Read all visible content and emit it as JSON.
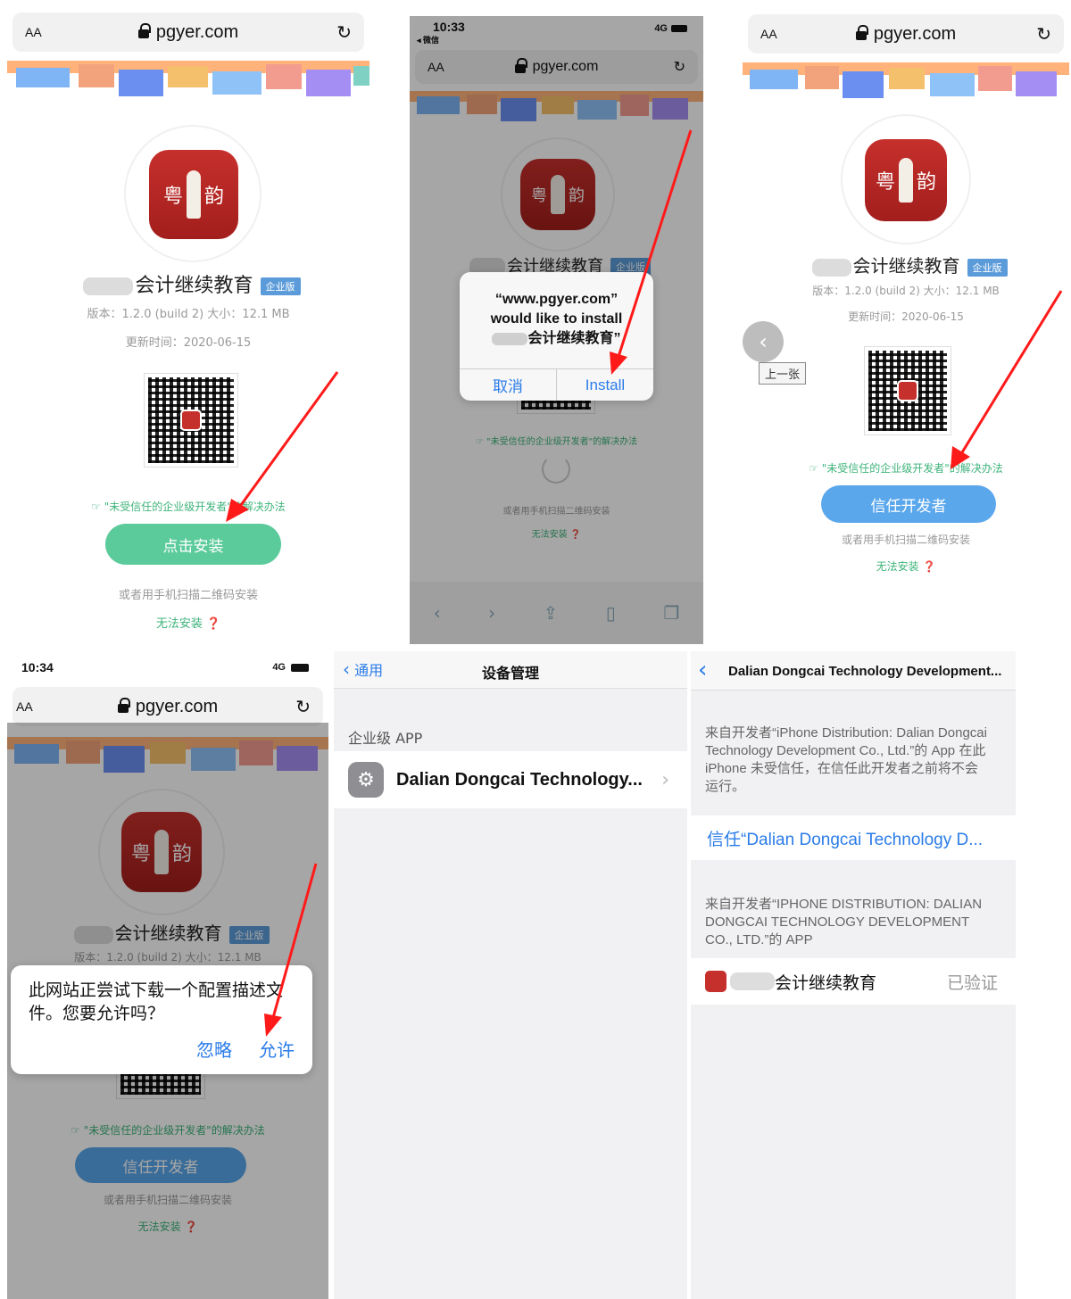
{
  "shared": {
    "aa": "AA",
    "reload": "↻",
    "app_suffix": "会计继续教育",
    "badge": "企业版",
    "version": "版本：1.2.0 (build 2)   大小：12.1 MB",
    "updated": "更新时间：2020-06-15",
    "untrusted_link": "\"未受信任的企业级开发者\"的解决办法",
    "scan_text": "或者用手机扫描二维码安装",
    "cannot_install": "无法安装"
  },
  "screen1": {
    "url": "pgyer.com",
    "install_button": "点击安装"
  },
  "screen2": {
    "time": "10:33",
    "back_app": "◂ 微信",
    "signal": "4G",
    "url": "pgyer.com",
    "alert_line1": "“www.pgyer.com”",
    "alert_line2": "would like to install",
    "alert_line3": "会计继续教育”",
    "cancel": "取消",
    "install": "Install"
  },
  "screen3": {
    "url": "pgyer.com",
    "prev_tooltip": "上一张",
    "trust_button": "信任开发者"
  },
  "screen4": {
    "time": "10:34",
    "signal": "4G",
    "url": "pgyer.com",
    "alert_text": "此网站正尝试下载一个配置描述文件。您要允许吗？",
    "ignore": "忽略",
    "allow": "允许",
    "trust_button": "信任开发者"
  },
  "screen5": {
    "back": "通用",
    "title": "设备管理",
    "section": "企业级 APP",
    "item": "Dalian Dongcai Technology..."
  },
  "screen6": {
    "title": "Dalian Dongcai Technology Development...",
    "desc": "来自开发者“iPhone Distribution: Dalian Dongcai Technology Development Co., Ltd.”的 App 在此 iPhone 未受信任，在信任此开发者之前将不会运行。",
    "trust_link": "信任“Dalian Dongcai Technology D...",
    "section": "来自开发者“IPHONE DISTRIBUTION: DALIAN DONGCAI TECHNOLOGY DEVELOPMENT CO., LTD.”的 APP",
    "app_name": "会计继续教育",
    "verified": "已验证"
  },
  "colors": {
    "green": "#5ccb9b",
    "blue": "#5aa7ec",
    "ios_blue": "#2b7ce9",
    "arrow_red": "#ff1a1a"
  }
}
